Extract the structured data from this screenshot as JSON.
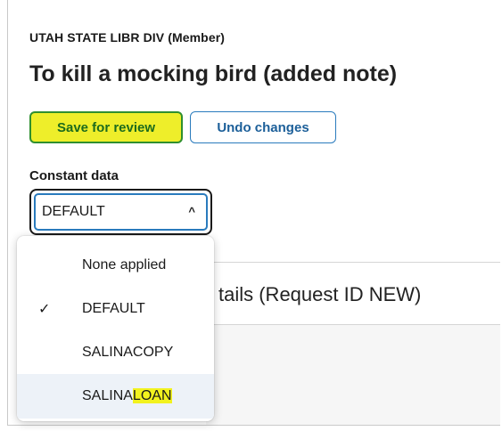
{
  "header": {
    "organization": "UTAH STATE LIBR DIV (Member)",
    "title": "To kill a mocking bird (added note)"
  },
  "actions": {
    "save_label": "Save for review",
    "undo_label": "Undo changes"
  },
  "constant_data": {
    "label": "Constant data",
    "selected": "DEFAULT",
    "options": [
      {
        "label": "None applied",
        "checked": false
      },
      {
        "label": "DEFAULT",
        "checked": true
      },
      {
        "label": "SALINACOPY",
        "checked": false
      },
      {
        "label_prefix": "SALINA",
        "label_highlight": "LOAN",
        "checked": false
      }
    ],
    "check_glyph": "✓",
    "caret_glyph": "^"
  },
  "panel": {
    "title_partial": "tails (Request ID NEW)"
  },
  "colors": {
    "save_bg": "#eeee2a",
    "accent_blue": "#2a7bbd",
    "highlight": "#f2f21e"
  }
}
